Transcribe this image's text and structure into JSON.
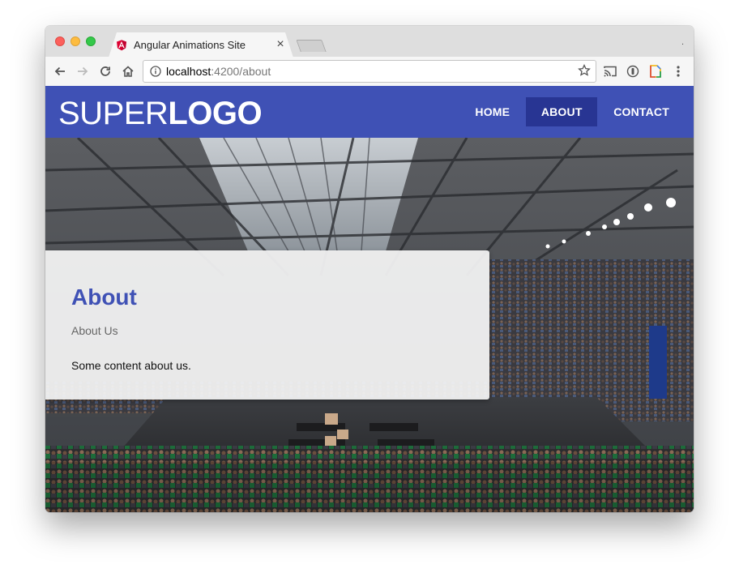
{
  "browser": {
    "tab_title": "Angular Animations Site",
    "tab_close": "×",
    "tab_icon": "angular-icon",
    "toolbar_dot": ".",
    "url_host": "localhost",
    "url_path": ":4200/about"
  },
  "app": {
    "logo_light": "SUPER",
    "logo_bold": "LOGO",
    "brand_color": "#3f51b5",
    "active_color": "#283593",
    "nav": [
      {
        "label": "HOME"
      },
      {
        "label": "ABOUT"
      },
      {
        "label": "CONTACT"
      }
    ],
    "active_nav": "ABOUT"
  },
  "card": {
    "title": "About",
    "subtitle": "About Us",
    "content": "Some content about us."
  }
}
